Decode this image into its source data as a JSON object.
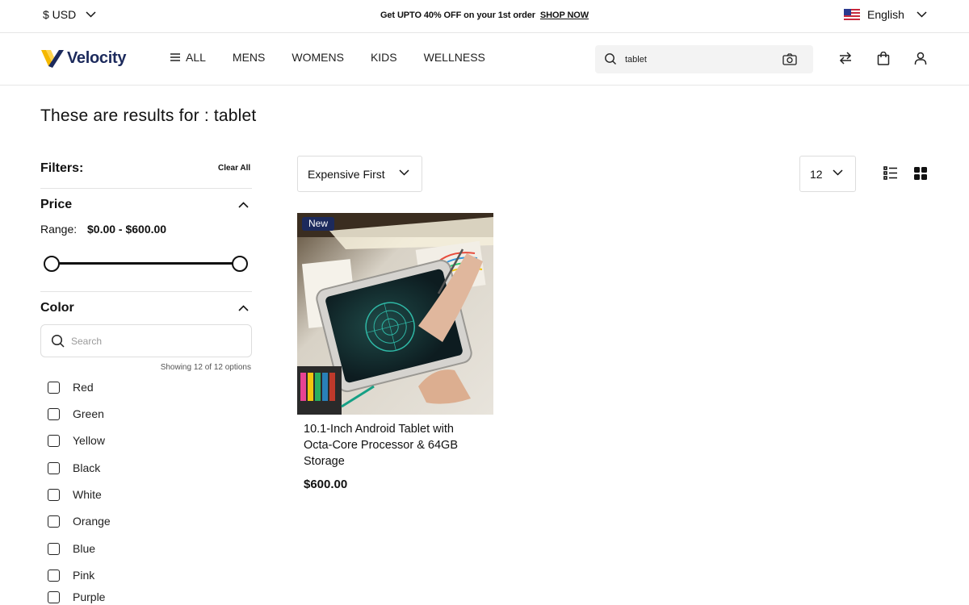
{
  "topbar": {
    "currency": "$ USD",
    "promo_text": "Get UPTO 40% OFF on your 1st order",
    "promo_link": "SHOP NOW",
    "language": "English"
  },
  "header": {
    "logo_text": "Velocity",
    "nav": [
      "ALL",
      "MENS",
      "WOMENS",
      "KIDS",
      "WELLNESS"
    ],
    "search_value": "tablet",
    "icons": [
      "compare-icon",
      "bag-icon",
      "user-icon"
    ]
  },
  "results": {
    "heading": "These are results for : tablet"
  },
  "filters": {
    "label": "Filters:",
    "clear_all": "Clear All",
    "price": {
      "title": "Price",
      "range_label": "Range:",
      "range_value": "$0.00 - $600.00",
      "min": 0,
      "max": 600
    },
    "color": {
      "title": "Color",
      "search_placeholder": "Search",
      "showing": "Showing 12 of 12 options",
      "options": [
        "Red",
        "Green",
        "Yellow",
        "Black",
        "White",
        "Orange",
        "Blue",
        "Pink",
        "Purple"
      ]
    }
  },
  "toolbar": {
    "sort": "Expensive First",
    "per_page": "12"
  },
  "products": [
    {
      "badge": "New",
      "title": "10.1-Inch Android Tablet with Octa-Core Processor & 64GB Storage",
      "price": "$600.00"
    }
  ],
  "colors": {
    "brand_navy": "#1c2a5c",
    "logo_yellow": "#f5b800"
  }
}
